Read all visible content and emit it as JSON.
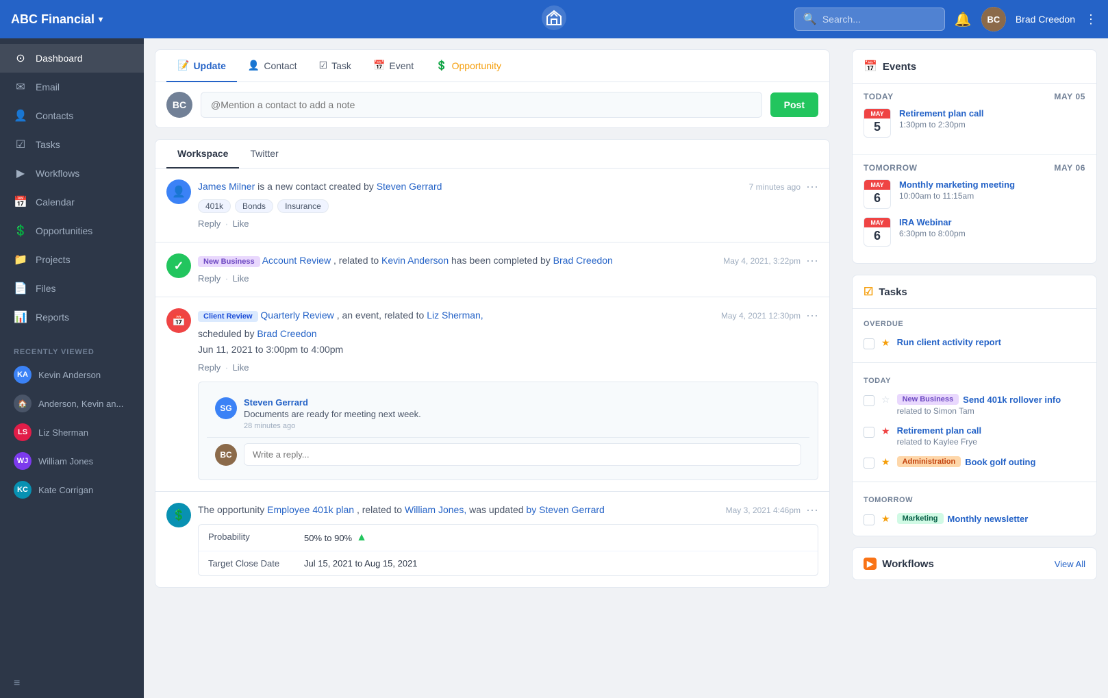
{
  "app": {
    "brand": "ABC Financial",
    "logo_unicode": "🏠"
  },
  "topnav": {
    "search_placeholder": "Search...",
    "user_name": "Brad Creedon",
    "bell": "🔔",
    "more": "⋮"
  },
  "sidebar": {
    "items": [
      {
        "id": "dashboard",
        "label": "Dashboard",
        "icon": "⊙",
        "active": true
      },
      {
        "id": "email",
        "label": "Email",
        "icon": "✉"
      },
      {
        "id": "contacts",
        "label": "Contacts",
        "icon": "👤"
      },
      {
        "id": "tasks",
        "label": "Tasks",
        "icon": "☑"
      },
      {
        "id": "workflows",
        "label": "Workflows",
        "icon": "▶"
      },
      {
        "id": "calendar",
        "label": "Calendar",
        "icon": "📅"
      },
      {
        "id": "opportunities",
        "label": "Opportunities",
        "icon": "💲"
      },
      {
        "id": "projects",
        "label": "Projects",
        "icon": "📁"
      },
      {
        "id": "files",
        "label": "Files",
        "icon": "📄"
      },
      {
        "id": "reports",
        "label": "Reports",
        "icon": "📊"
      }
    ],
    "recently_viewed_label": "Recently Viewed",
    "recent_items": [
      {
        "id": "kevin-anderson",
        "label": "Kevin Anderson",
        "avatar_text": "KA",
        "avatar_color": "#3b82f6"
      },
      {
        "id": "anderson-kevin",
        "label": "Anderson, Kevin an...",
        "avatar_text": "🏠",
        "avatar_color": "#4a5568",
        "is_house": true
      },
      {
        "id": "liz-sherman",
        "label": "Liz Sherman",
        "avatar_text": "LS",
        "avatar_color": "#e11d48"
      },
      {
        "id": "william-jones",
        "label": "William Jones",
        "avatar_text": "WJ",
        "avatar_color": "#7c3aed"
      },
      {
        "id": "kate-corrigan",
        "label": "Kate Corrigan",
        "avatar_text": "KC",
        "avatar_color": "#0891b2"
      }
    ]
  },
  "compose": {
    "tabs": [
      {
        "id": "update",
        "label": "Update",
        "icon": "📝",
        "active": true
      },
      {
        "id": "contact",
        "label": "Contact",
        "icon": "👤"
      },
      {
        "id": "task",
        "label": "Task",
        "icon": "☑"
      },
      {
        "id": "event",
        "label": "Event",
        "icon": "📅"
      },
      {
        "id": "opportunity",
        "label": "Opportunity",
        "icon": "💲"
      }
    ],
    "placeholder": "@Mention a contact to add a note",
    "post_button": "Post",
    "composer_avatar": "BC"
  },
  "feed": {
    "tabs": [
      {
        "id": "workspace",
        "label": "Workspace",
        "active": true
      },
      {
        "id": "twitter",
        "label": "Twitter"
      }
    ],
    "items": [
      {
        "id": "item1",
        "icon_type": "blue",
        "icon_char": "👤",
        "text_parts": [
          "James Milner",
          " is a new contact created by ",
          "Steven Gerrard"
        ],
        "time": "7 minutes ago",
        "tags": [
          "401k",
          "Bonds",
          "Insurance"
        ],
        "actions": [
          "Reply",
          "Like"
        ],
        "has_reply": false
      },
      {
        "id": "item2",
        "icon_type": "green",
        "icon_char": "✓",
        "badge": "New Business",
        "badge_type": "purple",
        "text_parts": [
          "Account Review",
          ", related to ",
          "Kevin Anderson",
          " has been completed by ",
          "Brad Creedon"
        ],
        "time": "May 4, 2021, 3:22pm",
        "actions": [
          "Reply",
          "Like"
        ],
        "has_reply": false
      },
      {
        "id": "item3",
        "icon_type": "red",
        "icon_char": "📅",
        "badge": "Client Review",
        "badge_type": "blue",
        "text_parts": [
          "Quarterly Review",
          ", an event, related to ",
          "Liz Sherman,"
        ],
        "text2": "scheduled by Brad Creedon",
        "text3": "Jun 11, 2021 to 3:00pm to 4:00pm",
        "time": "May 4, 2021 12:30pm",
        "actions": [
          "Reply",
          "Like"
        ],
        "has_reply": true,
        "reply_author": "Steven Gerrard",
        "reply_text": "Documents are ready for meeting next week.",
        "reply_time": "28 minutes  ago"
      },
      {
        "id": "item4",
        "icon_type": "teal",
        "icon_char": "💲",
        "text_intro": "The opportunity ",
        "text_link1": "Employee 401k plan",
        "text_mid": ", related to ",
        "text_link2": "William Jones,",
        "text_end": " was updated ",
        "text_link3": "by Steven Gerrard",
        "time": "May 3, 2021 4:46pm",
        "has_table": true,
        "table_rows": [
          {
            "label": "Probability",
            "value": "50% to 90%",
            "has_arrow": true
          },
          {
            "label": "Target Close Date",
            "value": "Jul 15, 2021 to Aug 15, 2021"
          }
        ]
      }
    ]
  },
  "events_widget": {
    "title": "Events",
    "icon": "📅",
    "sections": [
      {
        "label": "TODAY",
        "date": "May 05",
        "items": [
          {
            "month": "MAY",
            "day": "5",
            "title": "Retirement plan call",
            "time": "1:30pm to 2:30pm"
          }
        ]
      },
      {
        "label": "TOMORROW",
        "date": "May 06",
        "items": [
          {
            "month": "MAY",
            "day": "6",
            "title": "Monthly marketing meeting",
            "time": "10:00am to 11:15am"
          },
          {
            "month": "MAY",
            "day": "6",
            "title": "IRA Webinar",
            "time": "6:30pm to 8:00pm"
          }
        ]
      }
    ]
  },
  "tasks_widget": {
    "title": "Tasks",
    "icon": "☑",
    "sections": [
      {
        "label": "OVERDUE",
        "items": [
          {
            "id": "t1",
            "star": "yellow",
            "badge": null,
            "title": "Run client activity report",
            "sub": null
          }
        ]
      },
      {
        "label": "TODAY",
        "items": [
          {
            "id": "t2",
            "star": "outline",
            "badge": "New Business",
            "badge_type": "purple",
            "title": "Send 401k rollover info",
            "sub": "related to Simon Tam"
          },
          {
            "id": "t3",
            "star": "red",
            "badge": null,
            "title": "Retirement plan call",
            "sub": "related to Kaylee Frye"
          },
          {
            "id": "t4",
            "star": "yellow",
            "badge": "Administration",
            "badge_type": "orange",
            "title": "Book golf outing",
            "sub": null
          }
        ]
      },
      {
        "label": "TOMORROW",
        "items": [
          {
            "id": "t5",
            "star": "yellow",
            "badge": "Marketing",
            "badge_type": "green",
            "title": "Monthly newsletter",
            "sub": null
          }
        ]
      }
    ]
  },
  "workflows_widget": {
    "title": "Workflows",
    "icon": "▶",
    "action": "View All"
  }
}
